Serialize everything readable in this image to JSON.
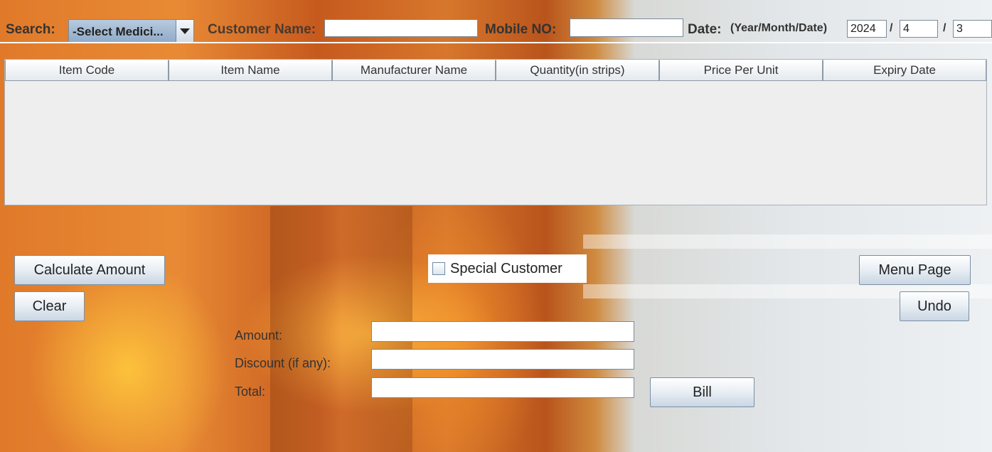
{
  "header": {
    "search_label": "Search:",
    "medicine_select": "-Select Medici...",
    "customer_name_label": "Customer Name:",
    "customer_name_value": "",
    "mobile_label": "Mobile NO:",
    "mobile_value": "",
    "date_label": "Date:",
    "date_format": "(Year/Month/Date)",
    "year": "2024",
    "month": "4",
    "day": "3",
    "separator": "/"
  },
  "table": {
    "columns": [
      "Item Code",
      "Item Name",
      "Manufacturer Name",
      "Quantity(in strips)",
      "Price Per Unit",
      "Expiry Date"
    ],
    "rows": []
  },
  "actions": {
    "calculate_amount": "Calculate Amount",
    "clear": "Clear",
    "special_customer": "Special Customer",
    "special_customer_checked": false,
    "menu_page": "Menu Page",
    "undo": "Undo",
    "bill": "Bill"
  },
  "billing": {
    "amount_label": "Amount:",
    "amount_value": "",
    "discount_label": "Discount (if any):",
    "discount_value": "",
    "total_label": "Total:",
    "total_value": ""
  }
}
